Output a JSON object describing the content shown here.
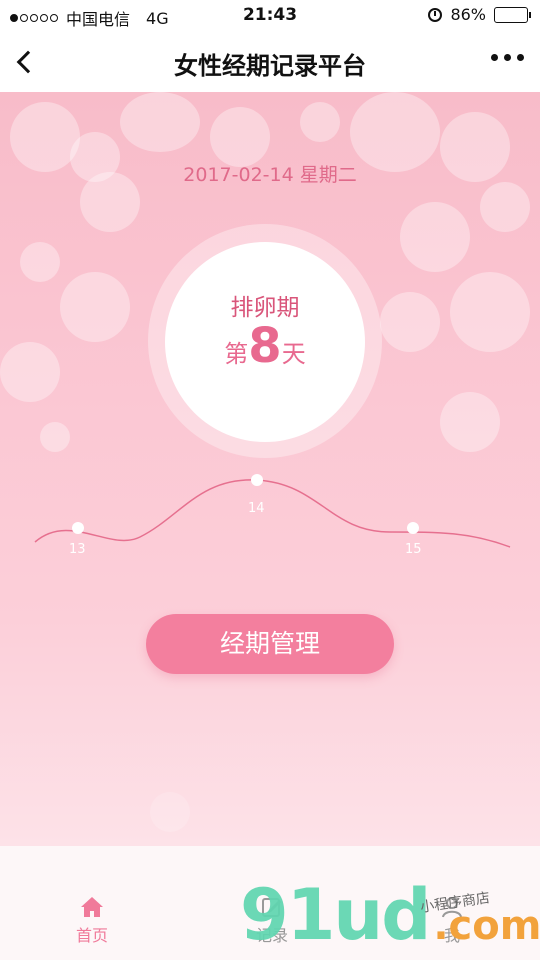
{
  "status_bar": {
    "carrier": "中国电信",
    "network": "4G",
    "time": "21:43",
    "battery": "86%",
    "battery_level": 0.86
  },
  "nav": {
    "title": "女性经期记录平台"
  },
  "main": {
    "date": "2017-02-14 星期二",
    "phase": "排卵期",
    "day_prefix": "第",
    "day_number": "8",
    "day_suffix": "天",
    "points": [
      {
        "label": "13"
      },
      {
        "label": "14"
      },
      {
        "label": "15"
      }
    ],
    "manage_button": "经期管理"
  },
  "tabs": [
    {
      "label": "首页",
      "icon": "home-icon",
      "active": true
    },
    {
      "label": "记录",
      "icon": "edit-icon",
      "active": false
    },
    {
      "label": "我",
      "icon": "user-icon",
      "active": false
    }
  ],
  "watermark": {
    "main": "91ud",
    "sub": ".com",
    "tag": "小程序商店"
  },
  "colors": {
    "accent": "#f37f9e",
    "accent_text": "#e06a8a"
  }
}
